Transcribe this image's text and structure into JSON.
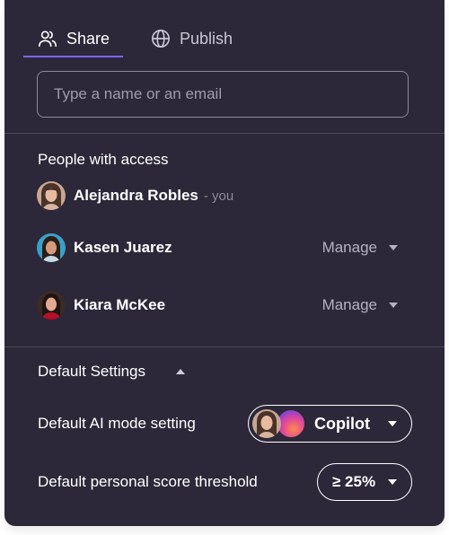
{
  "tabs": {
    "share": {
      "label": "Share",
      "icon": "people-icon"
    },
    "publish": {
      "label": "Publish",
      "icon": "globe-icon"
    },
    "active_color": "#7d63f0"
  },
  "search": {
    "placeholder": "Type a name or an email",
    "value": ""
  },
  "people": {
    "title": "People with access",
    "list": [
      {
        "name": "Alejandra Robles",
        "suffix": "- you",
        "avatar": "avatar-alejandra"
      },
      {
        "name": "Kasen Juarez",
        "role": "Manage",
        "avatar": "avatar-kasen"
      },
      {
        "name": "Kiara McKee",
        "role": "Manage",
        "avatar": "avatar-kiara"
      }
    ]
  },
  "defaults": {
    "title": "Default Settings",
    "ai_mode": {
      "label": "Default AI mode setting",
      "value": "Copilot"
    },
    "threshold": {
      "label": "Default personal score threshold",
      "value": "≥ 25%"
    }
  },
  "colors": {
    "panel_bg": "#2c2839",
    "divider": "#4b4659",
    "muted_text": "#b5b1c2"
  }
}
